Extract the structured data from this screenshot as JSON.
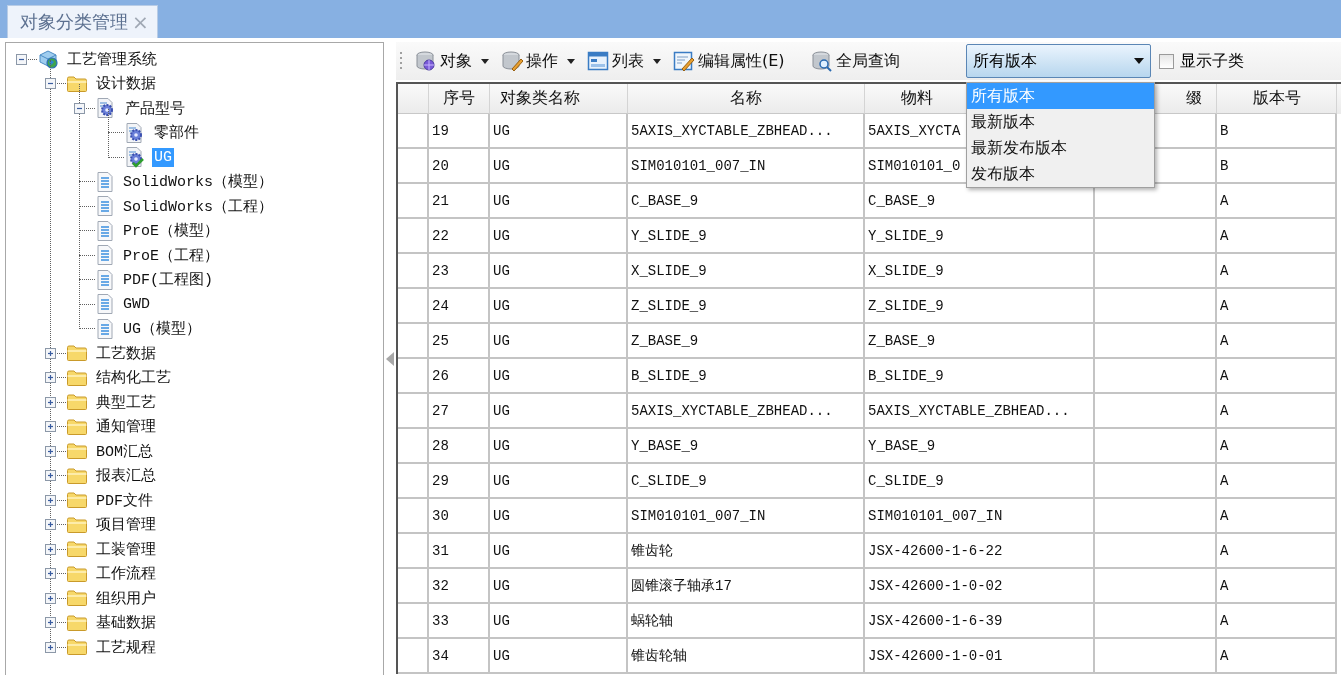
{
  "tabs": [
    {
      "label": "对象分类管理",
      "close": "×",
      "selected": true
    }
  ],
  "tree": [
    {
      "label": "工艺管理系统",
      "kind": "system",
      "expanded": true,
      "selected": false,
      "children": [
        {
          "label": "设计数据",
          "kind": "folder",
          "expanded": true,
          "selected": false,
          "children": [
            {
              "label": "产品型号",
              "kind": "gear-doc",
              "expanded": true,
              "selected": false,
              "children": [
                {
                  "label": "零部件",
                  "kind": "gear-doc",
                  "selected": false
                },
                {
                  "label": "UG",
                  "kind": "gear-doc-check",
                  "selected": true
                }
              ]
            },
            {
              "label": "SolidWorks（模型）",
              "kind": "doc",
              "selected": false
            },
            {
              "label": "SolidWorks（工程）",
              "kind": "doc",
              "selected": false
            },
            {
              "label": "ProE（模型）",
              "kind": "doc",
              "selected": false
            },
            {
              "label": "ProE（工程）",
              "kind": "doc",
              "selected": false
            },
            {
              "label": "PDF(工程图)",
              "kind": "doc",
              "selected": false
            },
            {
              "label": "GWD",
              "kind": "doc",
              "selected": false
            },
            {
              "label": "UG（模型）",
              "kind": "doc",
              "selected": false
            }
          ]
        },
        {
          "label": "工艺数据",
          "kind": "folder",
          "expanded": false,
          "selected": false
        },
        {
          "label": "结构化工艺",
          "kind": "folder",
          "expanded": false,
          "selected": false
        },
        {
          "label": "典型工艺",
          "kind": "folder",
          "expanded": false,
          "selected": false
        },
        {
          "label": "通知管理",
          "kind": "folder",
          "expanded": false,
          "selected": false
        },
        {
          "label": "BOM汇总",
          "kind": "folder",
          "expanded": false,
          "selected": false
        },
        {
          "label": "报表汇总",
          "kind": "folder",
          "expanded": false,
          "selected": false
        },
        {
          "label": "PDF文件",
          "kind": "folder",
          "expanded": false,
          "selected": false
        },
        {
          "label": "项目管理",
          "kind": "folder",
          "expanded": false,
          "selected": false
        },
        {
          "label": "工装管理",
          "kind": "folder",
          "expanded": false,
          "selected": false
        },
        {
          "label": "工作流程",
          "kind": "folder",
          "expanded": false,
          "selected": false
        },
        {
          "label": "组织用户",
          "kind": "folder",
          "expanded": false,
          "selected": false
        },
        {
          "label": "基础数据",
          "kind": "folder",
          "expanded": false,
          "selected": false
        },
        {
          "label": "工艺规程",
          "kind": "folder",
          "expanded": false,
          "selected": false
        }
      ]
    }
  ],
  "toolbar": [
    {
      "label": "对象",
      "has_menu": true
    },
    {
      "label": "操作",
      "has_menu": true
    },
    {
      "label": "列表",
      "has_menu": true
    },
    {
      "label": "编辑属性(E)",
      "has_menu": false
    },
    {
      "label": "全局查询",
      "has_menu": false
    }
  ],
  "version_filter": {
    "value": "所有版本",
    "open": true,
    "options": [
      {
        "label": "所有版本",
        "selected": true
      },
      {
        "label": "最新版本",
        "selected": false
      },
      {
        "label": "最新发布版本",
        "selected": false
      },
      {
        "label": "发布版本",
        "selected": false
      }
    ]
  },
  "show_subclasses": {
    "label": "显示子类",
    "checked": false
  },
  "table": {
    "columns": [
      {
        "label": "序号",
        "kind": "text"
      },
      {
        "label": "对象类名称",
        "kind": "text"
      },
      {
        "label": "名称",
        "kind": "text"
      },
      {
        "label": "物料",
        "kind": "text"
      },
      {
        "label": "缀",
        "kind": "empty"
      },
      {
        "label": "版本号",
        "kind": "text"
      }
    ],
    "rows": [
      {
        "cells": [
          "19",
          "UG",
          "5AXIS_XYCTABLE_ZBHEAD...",
          "5AXIS_XYCTA",
          "B"
        ]
      },
      {
        "cells": [
          "20",
          "UG",
          "SIM010101_007_IN",
          "SIM010101_0",
          "B"
        ]
      },
      {
        "cells": [
          "21",
          "UG",
          "C_BASE_9",
          "C_BASE_9",
          "A"
        ]
      },
      {
        "cells": [
          "22",
          "UG",
          "Y_SLIDE_9",
          "Y_SLIDE_9",
          "A"
        ]
      },
      {
        "cells": [
          "23",
          "UG",
          "X_SLIDE_9",
          "X_SLIDE_9",
          "A"
        ]
      },
      {
        "cells": [
          "24",
          "UG",
          "Z_SLIDE_9",
          "Z_SLIDE_9",
          "A"
        ]
      },
      {
        "cells": [
          "25",
          "UG",
          "Z_BASE_9",
          "Z_BASE_9",
          "A"
        ]
      },
      {
        "cells": [
          "26",
          "UG",
          "B_SLIDE_9",
          "B_SLIDE_9",
          "A"
        ]
      },
      {
        "cells": [
          "27",
          "UG",
          "5AXIS_XYCTABLE_ZBHEAD...",
          "5AXIS_XYCTABLE_ZBHEAD...",
          "A"
        ]
      },
      {
        "cells": [
          "28",
          "UG",
          "Y_BASE_9",
          "Y_BASE_9",
          "A"
        ]
      },
      {
        "cells": [
          "29",
          "UG",
          "C_SLIDE_9",
          "C_SLIDE_9",
          "A"
        ]
      },
      {
        "cells": [
          "30",
          "UG",
          "SIM010101_007_IN",
          "SIM010101_007_IN",
          "A"
        ]
      },
      {
        "cells": [
          "31",
          "UG",
          "锥齿轮",
          "JSX-42600-1-6-22",
          "A"
        ]
      },
      {
        "cells": [
          "32",
          "UG",
          "圆锥滚子轴承17",
          "JSX-42600-1-0-02",
          "A"
        ]
      },
      {
        "cells": [
          "33",
          "UG",
          "蜗轮轴",
          "JSX-42600-1-6-39",
          "A"
        ]
      },
      {
        "cells": [
          "34",
          "UG",
          "锥齿轮轴",
          "JSX-42600-1-0-01",
          "A"
        ]
      }
    ]
  }
}
